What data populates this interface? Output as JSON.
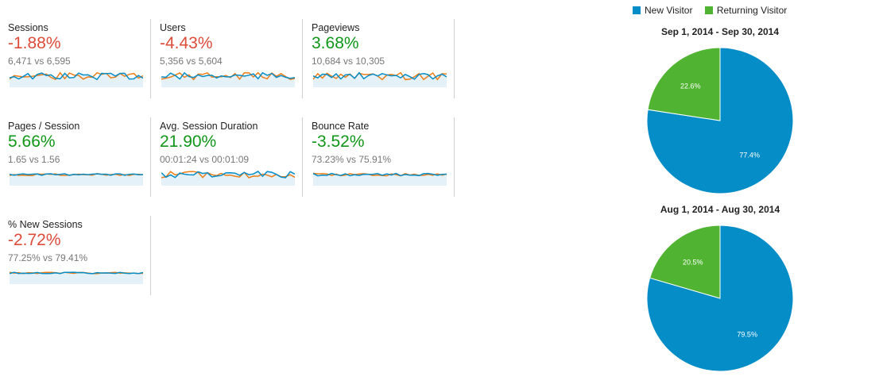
{
  "metrics": [
    {
      "name": "Sessions",
      "change": "-1.88%",
      "compare": "6,471 vs 6,595",
      "trend": "neg"
    },
    {
      "name": "Users",
      "change": "-4.43%",
      "compare": "5,356 vs 5,604",
      "trend": "neg"
    },
    {
      "name": "Pageviews",
      "change": "3.68%",
      "compare": "10,684 vs 10,305",
      "trend": "pos"
    },
    {
      "name": "Pages / Session",
      "change": "5.66%",
      "compare": "1.65 vs 1.56",
      "trend": "pos"
    },
    {
      "name": "Avg. Session Duration",
      "change": "21.90%",
      "compare": "00:01:24 vs 00:01:09",
      "trend": "pos"
    },
    {
      "name": "Bounce Rate",
      "change": "-3.52%",
      "compare": "73.23% vs 75.91%",
      "trend": "pos"
    },
    {
      "name": "% New Sessions",
      "change": "-2.72%",
      "compare": "77.25% vs 79.41%",
      "trend": "neg"
    }
  ],
  "colors": {
    "negative": "#dd4b39",
    "positive": "#109618",
    "new_visitor": "#058dc7",
    "returning_visitor": "#50b432",
    "spark_current": "#058dc7",
    "spark_previous": "#ed7e17",
    "spark_fill": "#e4f1f8"
  },
  "legend": {
    "new_visitor": "New Visitor",
    "returning_visitor": "Returning Visitor"
  },
  "chart_data": [
    {
      "type": "pie",
      "title": "Sep 1, 2014 - Sep 30, 2014",
      "categories": [
        "New Visitor",
        "Returning Visitor"
      ],
      "values": [
        77.4,
        22.6
      ],
      "labels": [
        "77.4%",
        "22.6%"
      ]
    },
    {
      "type": "pie",
      "title": "Aug 1, 2014 - Aug 30, 2014",
      "categories": [
        "New Visitor",
        "Returning Visitor"
      ],
      "values": [
        79.5,
        20.5
      ],
      "labels": [
        "79.5%",
        "20.5%"
      ]
    }
  ]
}
